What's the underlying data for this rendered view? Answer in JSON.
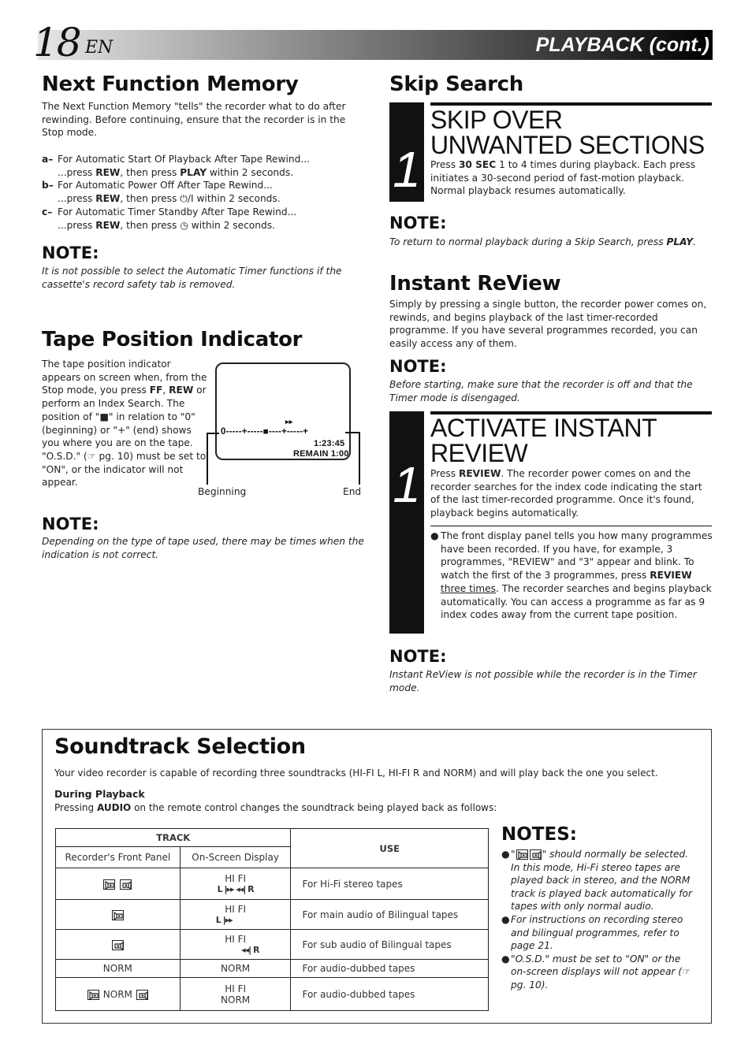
{
  "header": {
    "page_number": "18",
    "language": "EN",
    "section_title": "PLAYBACK (cont.)"
  },
  "next_function_memory": {
    "title": "Next Function Memory",
    "intro": "The Next Function Memory \"tells\" the recorder what to do after rewinding. Before continuing, ensure that the recorder is in the Stop mode.",
    "items": [
      {
        "key": "a–",
        "line1": "For Automatic Start Of Playback After Tape Rewind...",
        "pre": "...press ",
        "b1": "REW",
        "mid": ", then press ",
        "b2": "PLAY",
        "post": " within 2 seconds."
      },
      {
        "key": "b–",
        "line1": "For Automatic Power Off After Tape Rewind...",
        "pre": "...press ",
        "b1": "REW",
        "mid": ", then press ",
        "b2": "⏻/I",
        "post": " within 2 seconds."
      },
      {
        "key": "c–",
        "line1": "For Automatic Timer Standby After Tape Rewind...",
        "pre": "...press ",
        "b1": "REW",
        "mid": ", then press ",
        "b2": "◷",
        "post": " within 2 seconds."
      }
    ],
    "note_heading": "NOTE:",
    "note_text": "It is not possible to select the Automatic Timer functions if the cassette's record safety tab is removed."
  },
  "tape_position": {
    "title": "Tape Position Indicator",
    "text_parts": [
      "The tape position indicator appears on screen when, from the Stop mode, you press ",
      "FF",
      ", ",
      "REW",
      " or perform an Index Search. The position of \"■\" in relation to \"0\" (beginning) or \"+\" (end) shows you where you are on the tape.",
      "\"O.S.D.\" (☞ pg. 10) must be set to \"ON\", or the indicator will not appear."
    ],
    "osd": {
      "ff_symbol": "▸▸",
      "bar": "0-----+-----■----+-----+",
      "time": "1:23:45",
      "remain": "REMAIN 1:00"
    },
    "caption_beginning": "Beginning",
    "caption_end": "End",
    "note_heading": "NOTE:",
    "note_text": "Depending on the type of tape used, there may be times when the indication is not correct."
  },
  "skip_search": {
    "title": "Skip Search",
    "step_number": "1",
    "step_title": "SKIP OVER UNWANTED SECTIONS",
    "step_text_pre": "Press ",
    "step_text_bold": "30 SEC",
    "step_text_post": " 1 to 4 times during playback. Each press initiates a 30-second period of fast-motion playback. Normal playback resumes automatically.",
    "note_heading": "NOTE:",
    "note_text_pre": "To return to normal playback during a Skip Search, press ",
    "note_text_bold": "PLAY",
    "note_text_post": "."
  },
  "instant_review": {
    "title": "Instant ReView",
    "intro": "Simply by pressing a single button, the recorder power comes on, rewinds, and begins playback of the last timer-recorded programme. If you have several programmes recorded, you can easily access any of them.",
    "note1_heading": "NOTE:",
    "note1_text": "Before starting, make sure that the recorder is off and that the Timer mode is disengaged.",
    "step_number": "1",
    "step_title": "ACTIVATE INSTANT REVIEW",
    "step_text_pre": "Press ",
    "step_text_bold": "REVIEW",
    "step_text_post": ". The recorder power comes on and the recorder searches for the index code indicating the start of the last timer-recorded programme. Once it's found, playback begins automatically.",
    "bullet_pre": "The front display panel tells you how many programmes have been recorded. If you have, for example, 3 programmes, \"REVIEW\" and \"3\" appear and blink. To watch the first of the 3 programmes, press ",
    "bullet_bold": "REVIEW",
    "bullet_underline": "three times",
    "bullet_post": ". The recorder searches and begins playback automatically. You can access a programme as far as 9 index codes away from the current tape position.",
    "note2_heading": "NOTE:",
    "note2_text": "Instant ReView is not possible while the recorder is in the Timer mode."
  },
  "soundtrack": {
    "title": "Soundtrack Selection",
    "intro": "Your video recorder is capable of recording three soundtracks (HI-FI L, HI-FI R and NORM) and will play back the one you select.",
    "subheading": "During Playback",
    "sub_pre": "Pressing ",
    "sub_bold": "AUDIO",
    "sub_post": " on the remote control changes the soundtrack being played back as follows:",
    "table": {
      "header_track": "TRACK",
      "header_use": "USE",
      "col_front": "Recorder's Front Panel",
      "col_osd": "On-Screen Display",
      "rows": [
        {
          "front_icons": [
            "speaker-left",
            "speaker-right"
          ],
          "front_text": "",
          "osd_line1": "HI FI",
          "osd_line2": "L  |▸▸ ◂◂|  R",
          "use": "For Hi-Fi stereo tapes"
        },
        {
          "front_icons": [
            "speaker-left"
          ],
          "front_text": "",
          "osd_line1": "HI FI",
          "osd_line2": "L |▸▸",
          "use": "For main audio of Bilingual tapes"
        },
        {
          "front_icons": [
            "speaker-right"
          ],
          "front_text": "",
          "osd_line1": "HI FI",
          "osd_line2": "◂◂| R",
          "use": "For sub audio of Bilingual tapes"
        },
        {
          "front_icons": [],
          "front_text": "NORM",
          "osd_line1": "NORM",
          "osd_line2": "",
          "use": "For audio-dubbed tapes"
        },
        {
          "front_icons": [
            "speaker-left",
            "speaker-right"
          ],
          "front_text": "NORM",
          "osd_line1": "HI FI",
          "osd_line2": "NORM",
          "use": "For audio-dubbed tapes"
        }
      ]
    },
    "notes_heading": "NOTES:",
    "notes": [
      {
        "quote_pre": "\"",
        "quote_post": "\"",
        "text": " should normally be selected. In this mode, Hi-Fi stereo tapes are played back in stereo, and the NORM track is played back automatically for tapes with only normal audio."
      },
      {
        "text": "For instructions on recording stereo and bilingual programmes, refer to page 21."
      },
      {
        "text": "\"O.S.D.\" must be set to \"ON\" or the on-screen displays will not appear (☞ pg. 10)."
      }
    ]
  }
}
